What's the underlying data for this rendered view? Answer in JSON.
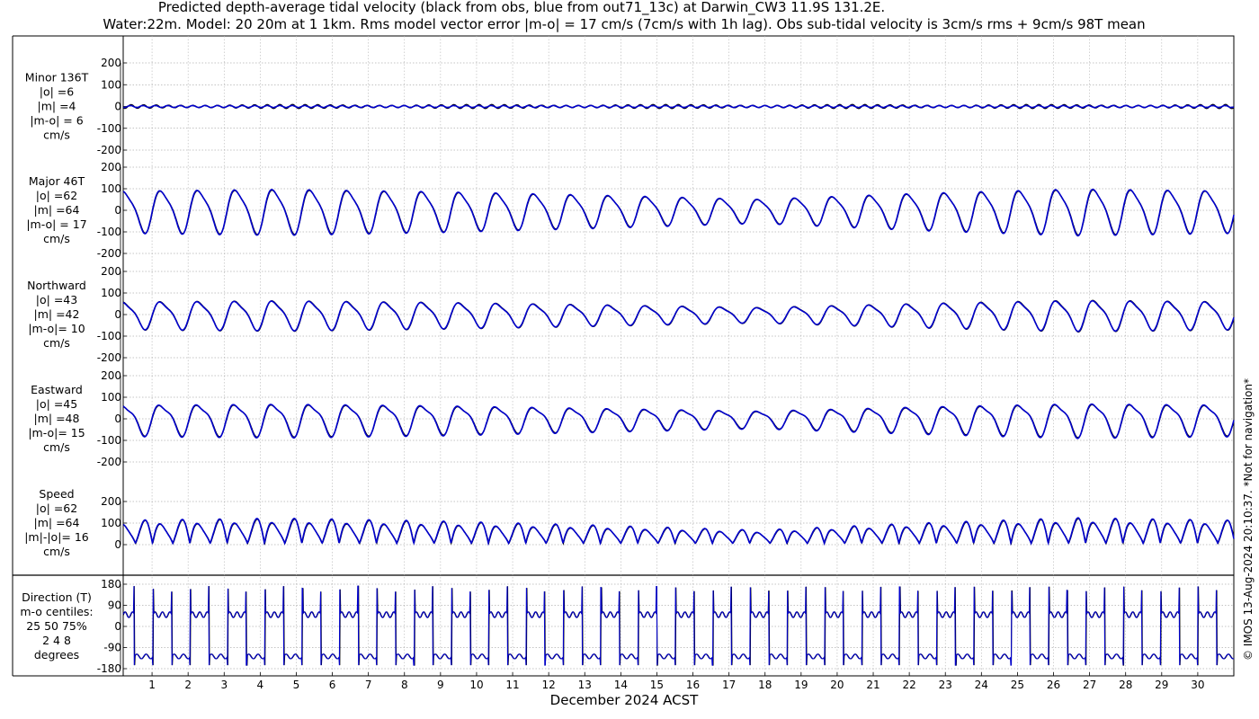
{
  "chart_data": {
    "type": "line",
    "title_line1": "Predicted depth-average tidal velocity (black from obs, blue from out71_13c) at Darwin_CW3 11.9S 131.2E.",
    "title_line2": "Water:22m. Model: 20 20m at 1 1km. Rms model vector error |m-o| = 17 cm/s (7cm/s with 1h lag). Obs sub-tidal velocity is 3cm/s rms + 9cm/s 98T mean",
    "xlabel": "December 2024 ACST",
    "xticks": [
      "1",
      "2",
      "3",
      "4",
      "5",
      "6",
      "7",
      "8",
      "9",
      "10",
      "11",
      "12",
      "13",
      "14",
      "15",
      "16",
      "17",
      "18",
      "19",
      "20",
      "21",
      "22",
      "23",
      "24",
      "25",
      "26",
      "27",
      "28",
      "29",
      "30"
    ],
    "xlim": [
      0.2,
      31.0
    ],
    "side_note": "© IMOS 13-Aug-2024 20:10:37. *Not for navigation*",
    "colors": {
      "obs": "#000000",
      "model": "#0000cc"
    },
    "series": [
      {
        "name": "obs"
      },
      {
        "name": "model"
      }
    ],
    "panels": [
      {
        "label": [
          "Minor 136T",
          "|o| =6",
          "|m| =4",
          "|m-o| = 6",
          "cm/s"
        ],
        "ylim": [
          -200,
          200
        ],
        "yticks": [
          "200",
          "100",
          "0",
          "-100",
          "-200"
        ],
        "kind": "minor",
        "obs_amp": [
          8,
          8,
          8,
          8,
          8,
          8,
          8,
          8
        ],
        "model_amp": [
          5,
          5,
          5,
          5,
          5,
          5,
          5,
          5
        ]
      },
      {
        "label": [
          "Major 46T",
          "|o| =62",
          "|m| =64",
          "|m-o| = 17",
          "cm/s"
        ],
        "ylim": [
          -200,
          200
        ],
        "yticks": [
          "200",
          "100",
          "0",
          "-100",
          "-200"
        ],
        "kind": "major",
        "obs_amp": [
          110,
          118,
          105,
          85,
          62,
          95,
          120,
          110
        ],
        "model_amp": [
          112,
          122,
          108,
          88,
          64,
          98,
          124,
          112
        ]
      },
      {
        "label": [
          "Northward",
          "|o| =43",
          "|m| =42",
          "|m-o|= 10",
          "cm/s"
        ],
        "ylim": [
          -200,
          200
        ],
        "yticks": [
          "200",
          "100",
          "0",
          "-100",
          "-200"
        ],
        "kind": "north",
        "obs_amp": [
          75,
          82,
          72,
          58,
          42,
          65,
          85,
          76
        ],
        "model_amp": [
          73,
          80,
          70,
          56,
          40,
          63,
          82,
          74
        ]
      },
      {
        "label": [
          "Eastward",
          "|o| =45",
          "|m| =48",
          "|m-o|= 15",
          "cm/s"
        ],
        "ylim": [
          -200,
          200
        ],
        "yticks": [
          "200",
          "100",
          "0",
          "-100",
          "-200"
        ],
        "kind": "east",
        "obs_amp": [
          82,
          88,
          78,
          62,
          45,
          70,
          90,
          82
        ],
        "model_amp": [
          85,
          92,
          82,
          65,
          48,
          74,
          94,
          86
        ]
      },
      {
        "label": [
          "Speed",
          "|o| =62",
          "|m| =64",
          "|m|-|o|= 16",
          "cm/s"
        ],
        "ylim": [
          0,
          200
        ],
        "yticks": [
          "200",
          "100",
          "0"
        ],
        "kind": "speed",
        "obs_amp": [
          110,
          118,
          105,
          85,
          62,
          95,
          120,
          110
        ],
        "model_amp": [
          112,
          122,
          108,
          88,
          64,
          98,
          124,
          112
        ]
      },
      {
        "label": [
          "Direction (T)",
          "m-o centiles:",
          "25  50  75%",
          "2   4   8",
          "degrees"
        ],
        "ylim": [
          -180,
          180
        ],
        "yticks": [
          "180",
          "90",
          "0",
          "-90",
          "-180"
        ],
        "kind": "direction"
      }
    ]
  }
}
